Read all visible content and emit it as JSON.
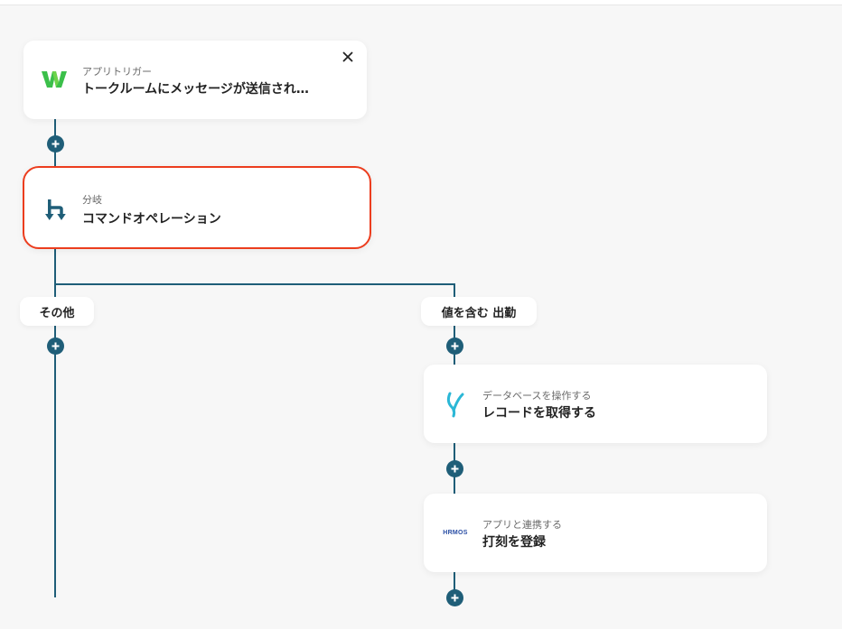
{
  "colors": {
    "connector": "#1f5e78",
    "selected_border": "#ec3d1e",
    "canvas_bg": "#f7f7f7",
    "yoom_green": "#3bbf4a",
    "kintone_cyan": "#2bb7d6",
    "hrmos_blue": "#2a4ea5"
  },
  "trigger": {
    "subtitle": "アプリトリガー",
    "title": "トークルームにメッセージが送信され…",
    "icon": "app-logo-w-icon"
  },
  "branch": {
    "subtitle": "分岐",
    "title": "コマンドオペレーション",
    "icon": "branch-icon"
  },
  "branches": {
    "left_label": "その他",
    "right_label": "値を含む 出勤"
  },
  "steps": [
    {
      "subtitle": "データベースを操作する",
      "title": "レコードを取得する",
      "icon": "database-app-icon"
    },
    {
      "subtitle": "アプリと連携する",
      "title": "打刻を登録",
      "icon": "hrmos-logo-icon",
      "logo_text": "HRMOS"
    }
  ]
}
